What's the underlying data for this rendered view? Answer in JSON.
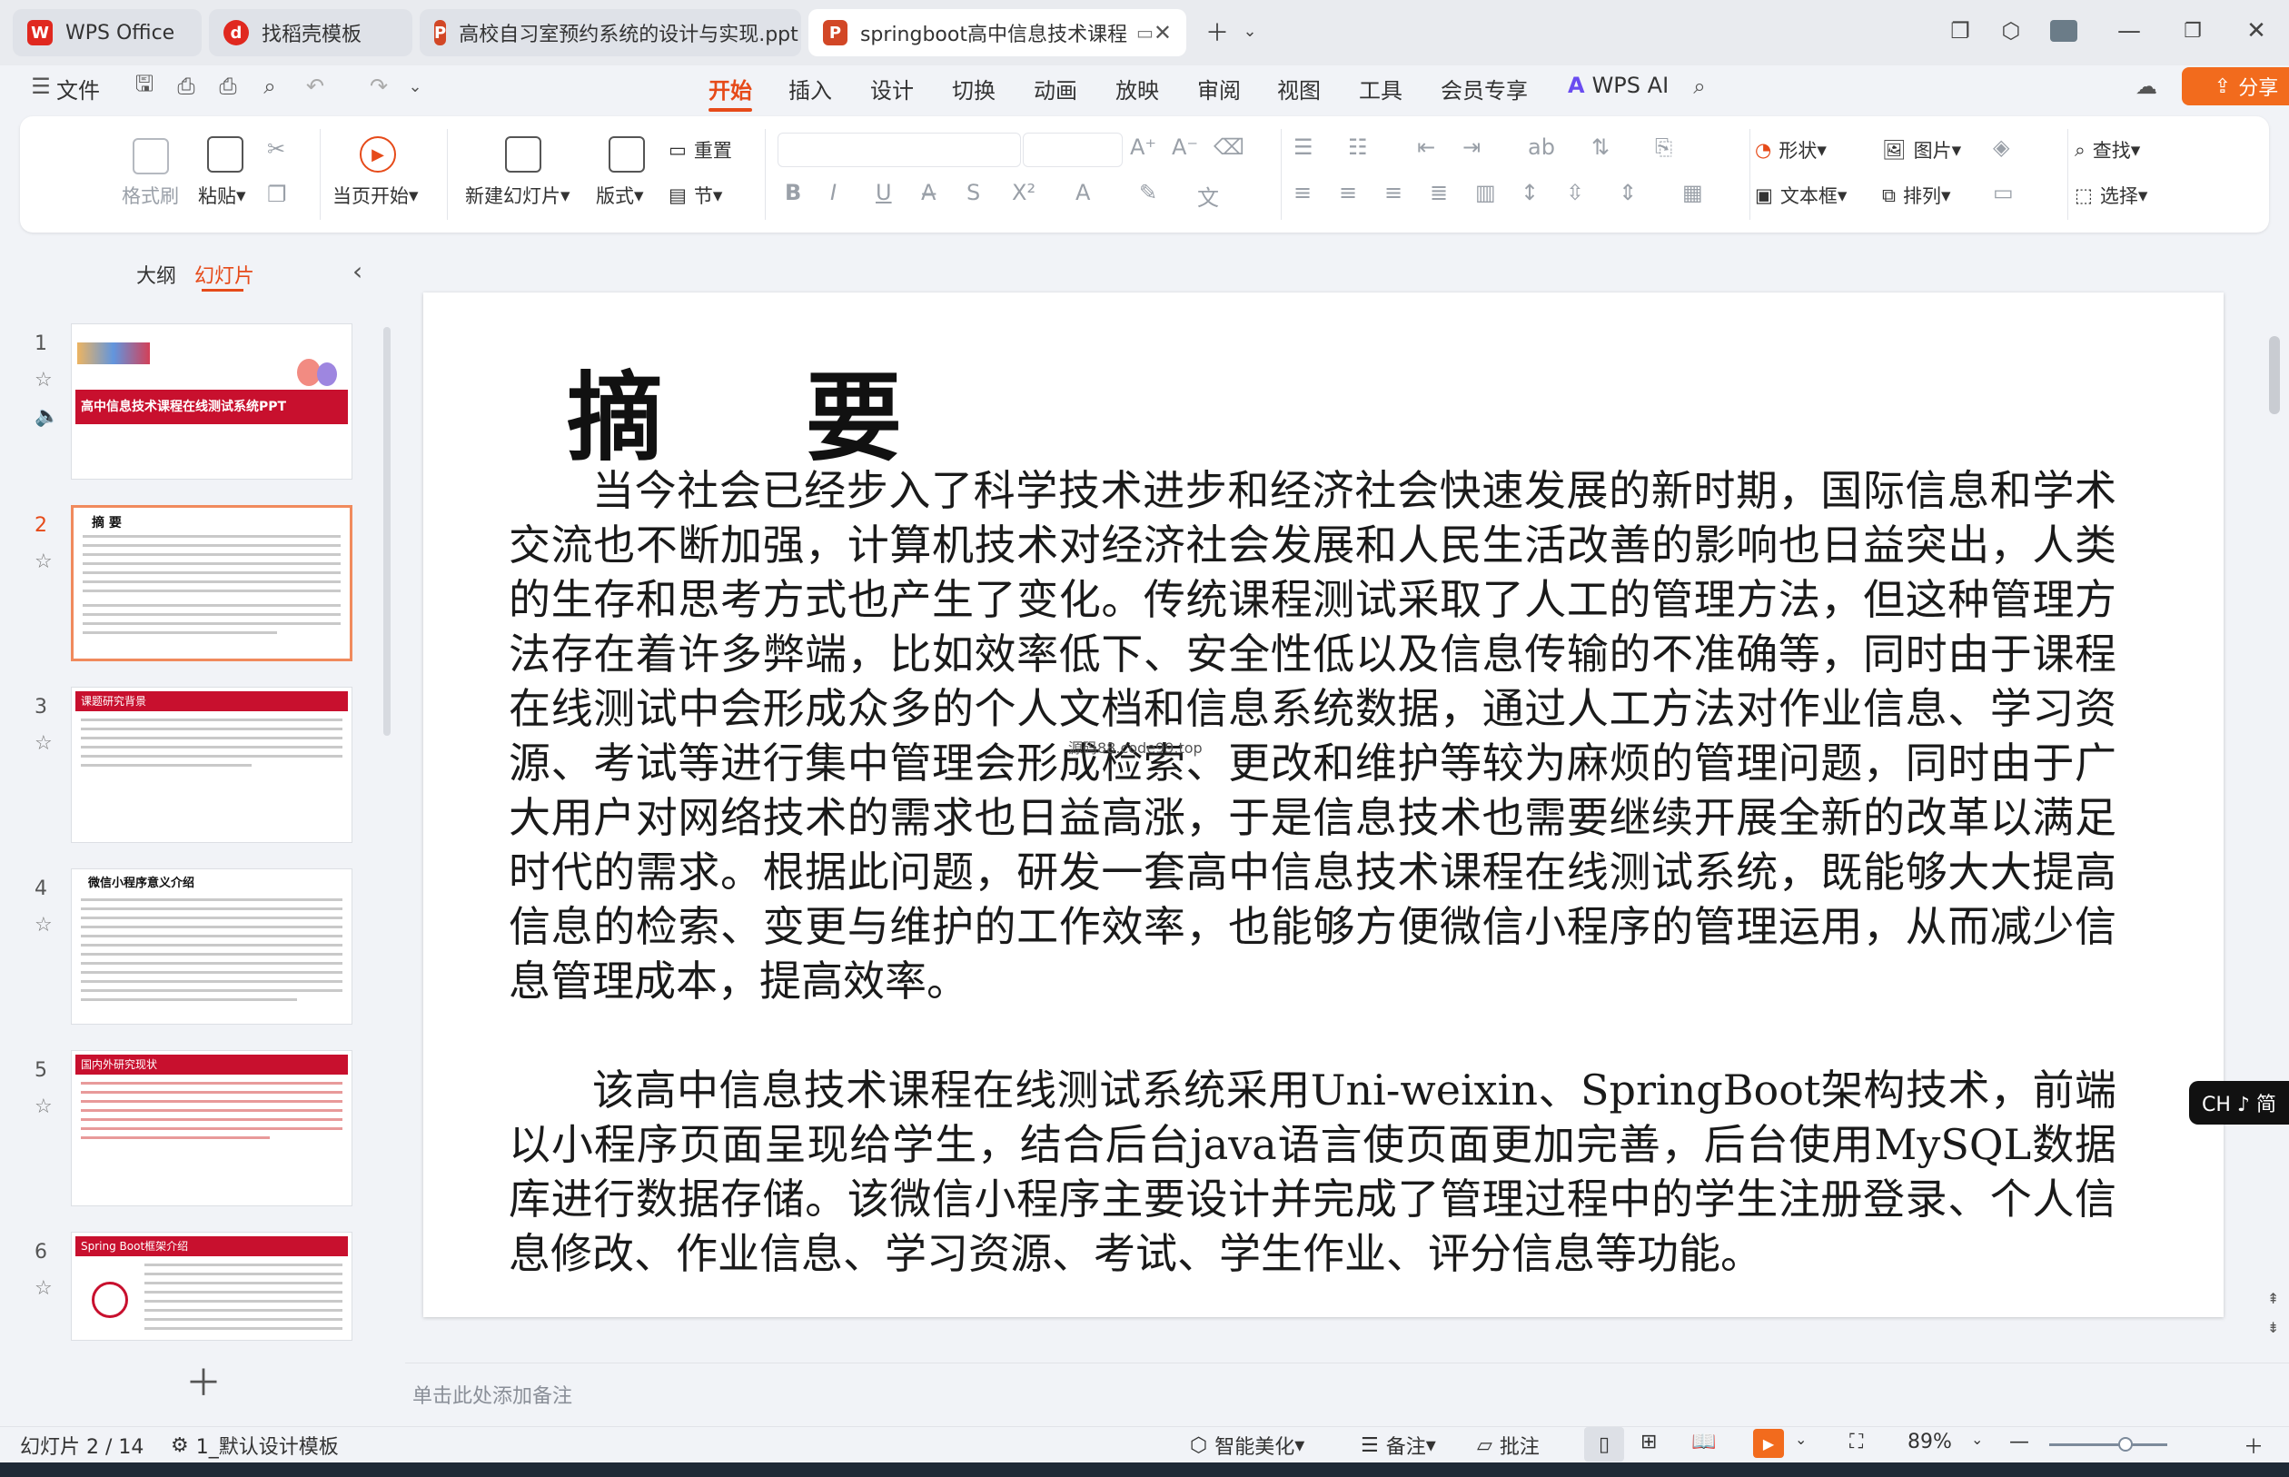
{
  "tabs": [
    {
      "label": "WPS Office",
      "icon": "wps-logo-icon"
    },
    {
      "label": "找稻壳模板",
      "icon": "docer-icon"
    },
    {
      "label": "高校自习室预约系统的设计与实现.ppt",
      "icon": "ppt-icon"
    },
    {
      "label": "springboot高中信息技术课程",
      "icon": "ppt-icon"
    }
  ],
  "menu": {
    "file": "文件",
    "tabs": [
      "开始",
      "插入",
      "设计",
      "切换",
      "动画",
      "放映",
      "审阅",
      "视图",
      "工具",
      "会员专享"
    ],
    "active": "开始",
    "wps_ai": "WPS AI",
    "share": "分享"
  },
  "ribbon": {
    "format_painter": "格式刷",
    "paste": "粘贴",
    "play_from_current": "当页开始",
    "new_slide": "新建幻灯片",
    "layout": "版式",
    "reset": "重置",
    "section": "节",
    "shape": "形状",
    "picture": "图片",
    "textbox": "文本框",
    "arrange": "排列",
    "find": "查找",
    "select": "选择"
  },
  "panel": {
    "outline": "大纲",
    "slides": "幻灯片",
    "thumbnails": [
      {
        "num": "1",
        "title": "高中信息技术课程在线测试系统PPT"
      },
      {
        "num": "2",
        "title": "摘 要"
      },
      {
        "num": "3",
        "title": "课题研究背景"
      },
      {
        "num": "4",
        "title": "微信小程序意义介绍"
      },
      {
        "num": "5",
        "title": "国内外研究现状"
      },
      {
        "num": "6",
        "title": "Spring Boot框架介绍"
      }
    ]
  },
  "slide": {
    "title": "摘 要",
    "para1": "当今社会已经步入了科学技术进步和经济社会快速发展的新时期，国际信息和学术交流也不断加强，计算机技术对经济社会发展和人民生活改善的影响也日益突出，人类的生存和思考方式也产生了变化。传统课程测试采取了人工的管理方法，但这种管理方法存在着许多弊端，比如效率低下、安全性低以及信息传输的不准确等，同时由于课程在线测试中会形成众多的个人文档和信息系统数据，通过人工方法对作业信息、学习资源、考试等进行集中管理会形成检索、更改和维护等较为麻烦的管理问题，同时由于广大用户对网络技术的需求也日益高涨，于是信息技术也需要继续开展全新的改革以满足时代的需求。根据此问题，研发一套高中信息技术课程在线测试系统，既能够大大提高信息的检索、变更与维护的工作效率，也能够方便微信小程序的管理运用，从而减少信息管理成本，提高效率。",
    "para2": "该高中信息技术课程在线测试系统采用Uni-weixin、SpringBoot架构技术，前端以小程序页面呈现给学生，结合后台java语言使页面更加完善，后台使用MySQL数据库进行数据存储。该微信小程序主要设计并完成了管理过程中的学生注册登录、个人信息修改、作业信息、学习资源、考试、学生作业、评分信息等功能。",
    "watermark": "源码88.code99.top"
  },
  "notes_placeholder": "单击此处添加备注",
  "status": {
    "slide_count": "幻灯片 2 / 14",
    "template": "1_默认设计模板",
    "beautify": "智能美化",
    "notes": "备注",
    "comment": "批注",
    "zoom": "89%"
  },
  "ime": "CH ♪ 简",
  "colors": {
    "accent": "#e64a19",
    "share": "#f26b1d",
    "slide_red": "#c8102e"
  }
}
